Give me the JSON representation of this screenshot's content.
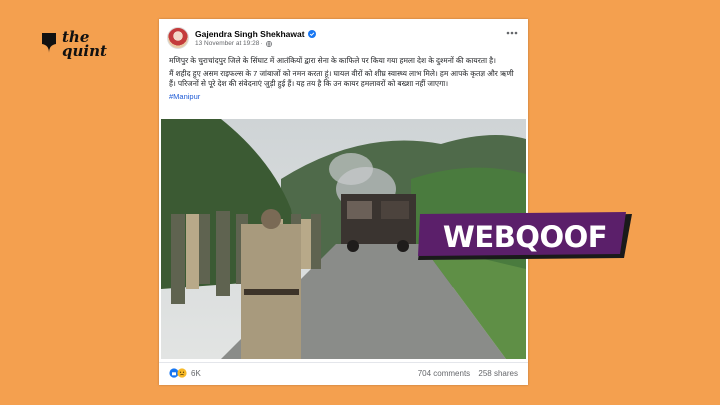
{
  "brand": {
    "name": "the quint",
    "icon": "pen-nib-icon"
  },
  "post": {
    "author": "Gajendra Singh Shekhawat",
    "verified_icon": "verified-badge-icon",
    "timestamp": "13 November at 19:28",
    "privacy_icon": "globe-icon",
    "menu_icon": "more-options-icon",
    "paragraph1": "मणिपुर के चुराचांदपुर जिले के सिंघाट में आतंकियों द्वारा सेना के काफिले पर किया गया हमला देश के दुश्मनों की कायरता है।",
    "paragraph2": "मैं शहीद हुए असम राइफल्स के 7 जांबाजों को नमन करता हूं। घायल वीरों को शीघ्र स्वास्थ्य लाभ मिले। हम आपके कृतज्ञ और ऋणी हैं। परिजनों से पूरे देश की संवेदनाएं जुड़ी हुई हैं। यह तय है कि उन कायर हमलावरों को बख्शा नहीं जाएगा।",
    "hashtag": "#Manipur",
    "photo_alt": "Soldiers near burned vehicle on forest road",
    "reaction_icons": "like-sad-reaction-icons",
    "reactions_count": "6K",
    "comments": "704 comments",
    "shares": "258 shares"
  },
  "badge": {
    "text": "WEBQOOF"
  },
  "colors": {
    "background": "#f4a04f",
    "badge_bg": "#5b1f6a",
    "badge_shadow": "#1a1a1a",
    "link": "#1f5bd6"
  }
}
